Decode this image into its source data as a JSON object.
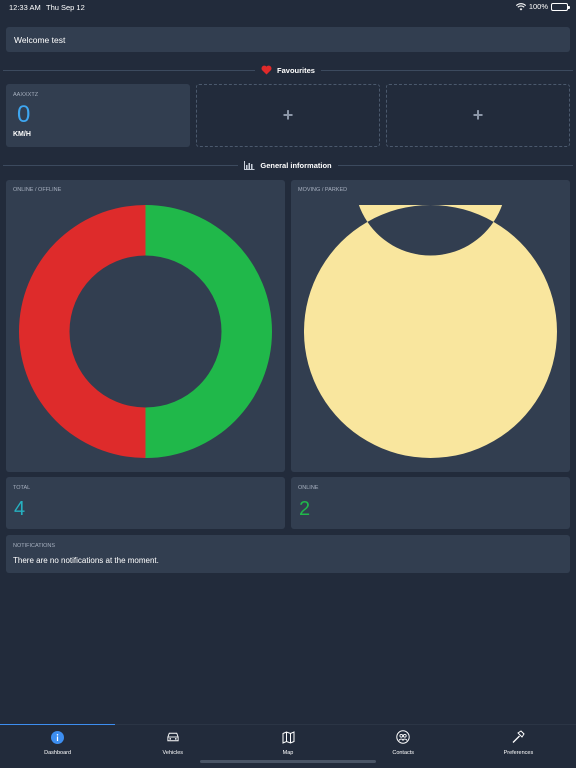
{
  "status_bar": {
    "time": "12:33 AM",
    "date": "Thu Sep 12",
    "battery": "100%"
  },
  "welcome": "Welcome test",
  "favourites": {
    "heading": "Favourites",
    "card": {
      "name": "AAXXXTZ",
      "speed": "0",
      "unit": "KM/H"
    },
    "empty_slot_label": "+"
  },
  "general": {
    "heading": "General information"
  },
  "charts": [
    {
      "title": "ONLINE / OFFLINE"
    },
    {
      "title": "MOVING / PARKED"
    }
  ],
  "chart_data": [
    {
      "type": "pie",
      "title": "ONLINE / OFFLINE",
      "donut": true,
      "slices": [
        {
          "name": "",
          "value": 2,
          "color": "#20b84a"
        },
        {
          "name": "",
          "value": 2,
          "color": "#de2b2b"
        }
      ]
    },
    {
      "type": "pie",
      "title": "MOVING / PARKED",
      "donut": true,
      "slices": [
        {
          "name": "",
          "value": 1,
          "color": "#f9e69e"
        }
      ]
    }
  ],
  "stats": {
    "total": {
      "title": "TOTAL",
      "value": "4",
      "color": "#26b0c0"
    },
    "online": {
      "title": "ONLINE",
      "value": "2",
      "color": "#20b84a"
    }
  },
  "notifications": {
    "title": "NOTIFICATIONS",
    "text": "There are no notifications at the moment."
  },
  "tabs": [
    {
      "label": "Dashboard",
      "icon": "info-icon",
      "active": true
    },
    {
      "label": "Vehicles",
      "icon": "car-icon",
      "active": false
    },
    {
      "label": "Map",
      "icon": "map-icon",
      "active": false
    },
    {
      "label": "Contacts",
      "icon": "contacts-icon",
      "active": false
    },
    {
      "label": "Preferences",
      "icon": "hammer-icon",
      "active": false
    }
  ],
  "colors": {
    "accent": "#3d8ef0",
    "background": "#222b3b",
    "card": "#323e50",
    "heart": "#e02a2a"
  }
}
